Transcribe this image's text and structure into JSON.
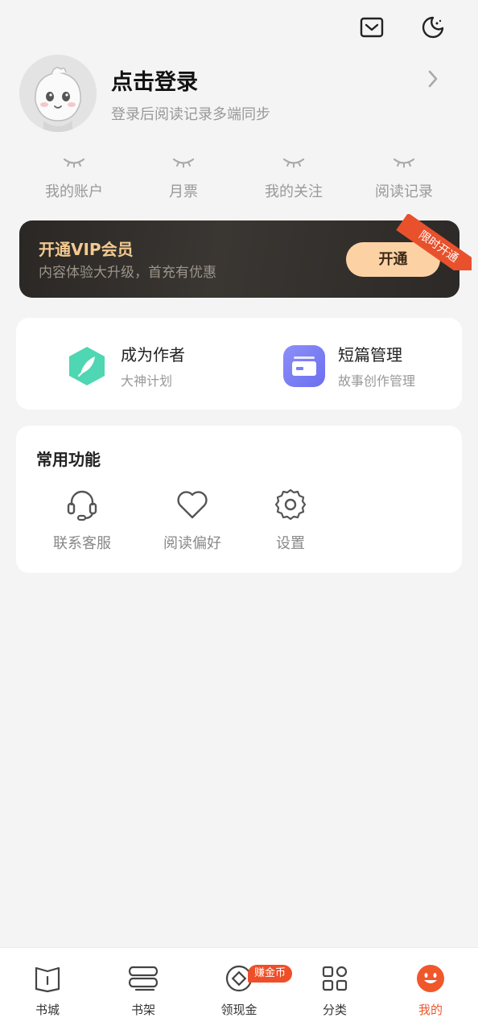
{
  "header": {
    "icons": [
      "mail-icon",
      "moon-icon"
    ]
  },
  "profile": {
    "title": "点击登录",
    "subtitle": "登录后阅读记录多端同步"
  },
  "stats": [
    {
      "label": "我的账户"
    },
    {
      "label": "月票"
    },
    {
      "label": "我的关注"
    },
    {
      "label": "阅读记录"
    }
  ],
  "vip": {
    "title": "开通VIP会员",
    "subtitle": "内容体验大升级，首充有优惠",
    "button": "开通",
    "ribbon": "限时开通",
    "colors": {
      "gold": "#f3c98f",
      "button": "#fcd2a4",
      "ribbon": "#e8512c"
    }
  },
  "features": [
    {
      "title": "成为作者",
      "subtitle": "大神计划",
      "icon": "quill-icon",
      "color": "#4fd6b2"
    },
    {
      "title": "短篇管理",
      "subtitle": "故事创作管理",
      "icon": "folder-icon",
      "color": "#7c7ff5"
    }
  ],
  "common": {
    "title": "常用功能",
    "items": [
      {
        "label": "联系客服",
        "icon": "headset-icon"
      },
      {
        "label": "阅读偏好",
        "icon": "heart-icon"
      },
      {
        "label": "设置",
        "icon": "gear-icon"
      }
    ]
  },
  "nav": {
    "items": [
      {
        "label": "书城",
        "icon": "book-icon"
      },
      {
        "label": "书架",
        "icon": "bookshelf-icon"
      },
      {
        "label": "领现金",
        "icon": "coin-icon"
      },
      {
        "label": "分类",
        "icon": "grid-icon"
      },
      {
        "label": "我的",
        "icon": "smile-icon",
        "active": true
      }
    ],
    "badge": "赚金币",
    "accent": "#f0572b"
  }
}
